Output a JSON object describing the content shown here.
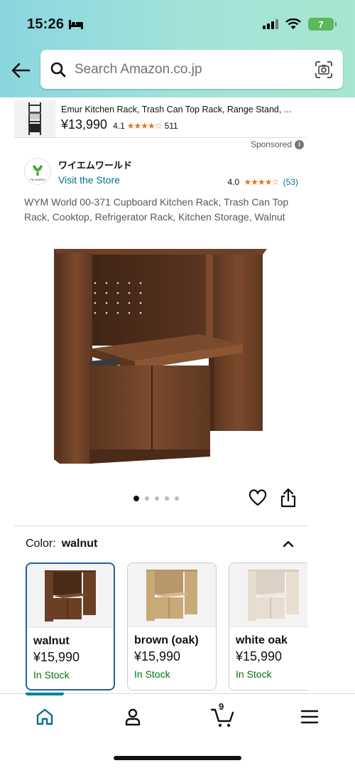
{
  "status_bar": {
    "time": "15:26",
    "battery": "7"
  },
  "search": {
    "placeholder": "Search Amazon.co.jp"
  },
  "sponsored_top": {
    "title": "Emur Kitchen Rack, Trash Can Top Rack, Range Stand, ...",
    "price": "¥13,990",
    "rating": "4.1",
    "stars": "★★★★☆",
    "review_count": "511"
  },
  "sponsored_label": "Sponsored",
  "store": {
    "name": "ワイエムワールド",
    "logo_text": "YM WORLD",
    "link": "Visit the Store",
    "rating": "4.0",
    "stars": "★★★★☆",
    "review_count": "(53)"
  },
  "product": {
    "title": "WYM World 00-371 Cupboard Kitchen Rack, Trash Can Top Rack, Cooktop, Refrigerator Rack, Kitchen Storage, Walnut"
  },
  "carousel": {
    "total": 5,
    "active_index": 0
  },
  "color": {
    "label": "Color:",
    "selected": "walnut",
    "options": [
      {
        "name": "walnut",
        "price": "¥15,990",
        "stock": "In Stock",
        "tone": "#6b3f24"
      },
      {
        "name": "brown (oak)",
        "price": "¥15,990",
        "stock": "In Stock",
        "tone": "#c9a977"
      },
      {
        "name": "white oak",
        "price": "¥15,990",
        "stock": "In Stock",
        "tone": "#e8ddd1"
      }
    ]
  },
  "bottom_nav": {
    "cart_count": "9"
  },
  "colors": {
    "link": "#007185",
    "stock": "#007600",
    "selected_border": "#2162a1",
    "accent": "#008296",
    "star": "#de7921"
  }
}
